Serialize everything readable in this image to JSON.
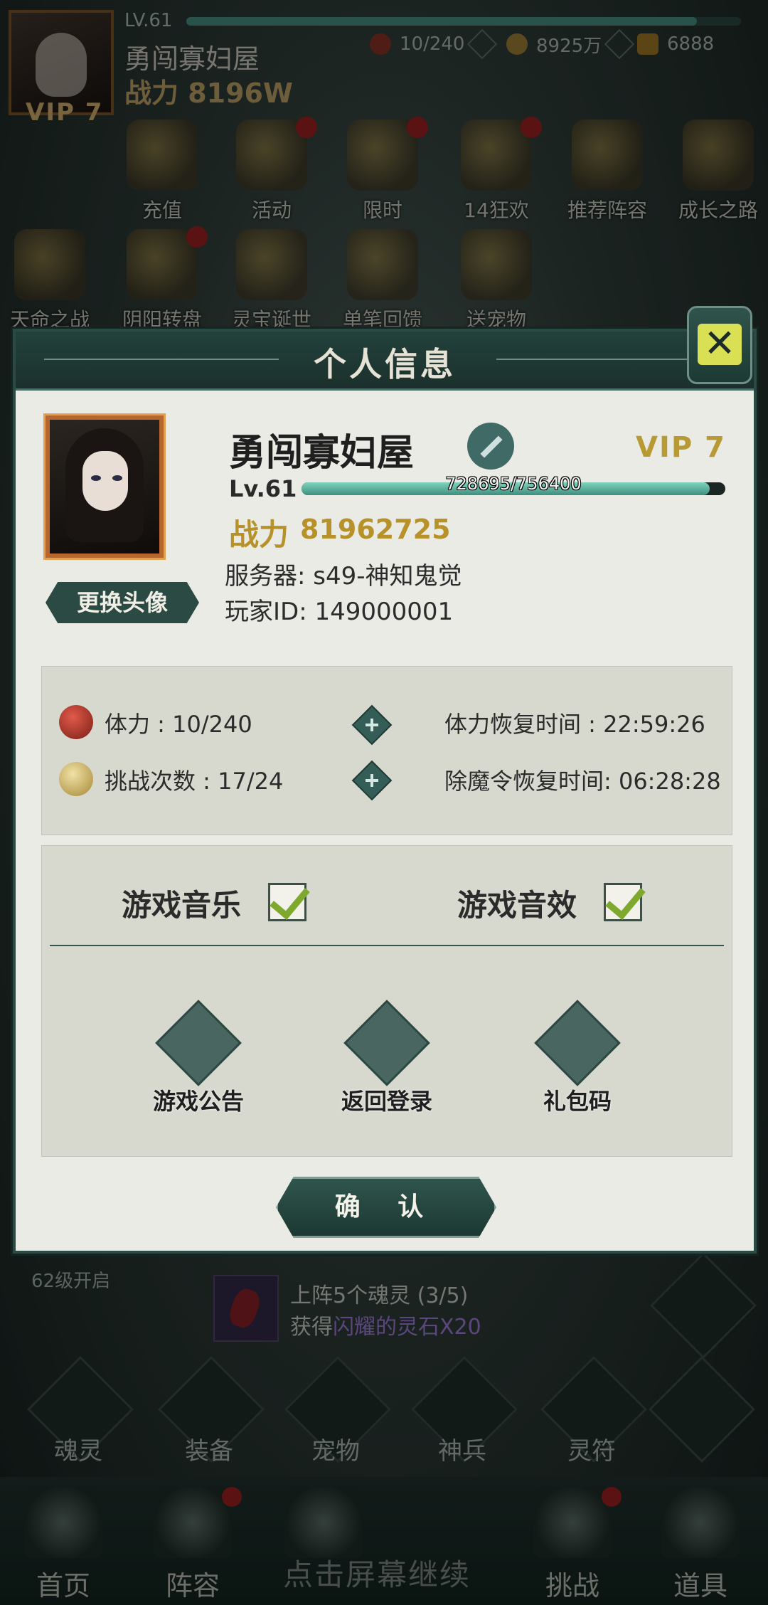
{
  "hud": {
    "level": "LV.61",
    "name": "勇闯寡妇屋",
    "power": "战力 8196W",
    "vip": "VIP 7",
    "stamina": "10/240",
    "gold": "8925万",
    "ingots": "6888"
  },
  "events_row1": [
    {
      "label": "充值",
      "icon": "recharge-icon",
      "dot": false
    },
    {
      "label": "活动",
      "icon": "activity-icon",
      "dot": true
    },
    {
      "label": "限时",
      "icon": "limited-icon",
      "dot": true
    },
    {
      "label": "14狂欢",
      "icon": "carnival-icon",
      "dot": true
    },
    {
      "label": "推荐阵容",
      "icon": "lineup-icon",
      "dot": false
    },
    {
      "label": "成长之路",
      "icon": "growth-icon",
      "dot": false
    }
  ],
  "events_row2": [
    {
      "label": "天命之战",
      "icon": "destiny-icon",
      "dot": false
    },
    {
      "label": "阴阳转盘",
      "icon": "wheel-icon",
      "dot": true
    },
    {
      "label": "灵宝诞世",
      "icon": "treasure-icon",
      "dot": false
    },
    {
      "label": "单笔回馈",
      "icon": "coins-icon",
      "dot": false
    },
    {
      "label": "送宠物",
      "icon": "rabbit-icon",
      "dot": false
    }
  ],
  "lower_hud": {
    "unlock_text": "62级开启",
    "quest_line1": "上阵5个魂灵 (3/5)",
    "quest_line2_prefix": "获得",
    "quest_line2_item": "闪耀的灵石X20",
    "side_buttons": [
      "魂灵",
      "装备",
      "宠物",
      "神兵",
      "灵符"
    ]
  },
  "bottom_tabs": [
    {
      "label": "首页",
      "dot": false
    },
    {
      "label": "阵容",
      "dot": true
    },
    {
      "label": "挑战",
      "dot": true
    },
    {
      "label": "道具",
      "dot": false
    }
  ],
  "screen_recording_caption": "点击屏幕继续",
  "panel": {
    "title": "个人信息",
    "name": "勇闯寡妇屋",
    "vip": "VIP 7",
    "level": "Lv.61",
    "exp_text": "728695/756400",
    "exp_fraction": 0.9634,
    "power_label": "战力",
    "power_value": "81962725",
    "server": "服务器: s49-神知鬼觉",
    "player_id": "玩家ID:  149000001",
    "change_avatar": "更换头像",
    "stamina_label": "体力 : 10/240",
    "stamina_recover": "体力恢复时间 : 22:59:26",
    "challenge_label": "挑战次数 : 17/24",
    "challenge_recover": "除魔令恢复时间: 06:28:28",
    "music_label": "游戏音乐",
    "sfx_label": "游戏音效",
    "music_on": true,
    "sfx_on": true,
    "actions": [
      {
        "label": "游戏公告",
        "icon": "announcement-icon"
      },
      {
        "label": "返回登录",
        "icon": "return-login-icon"
      },
      {
        "label": "礼包码",
        "icon": "gift-code-icon"
      }
    ],
    "confirm": "确 认"
  },
  "colors": {
    "panel_bg": "#e9ebe4",
    "header": "#23413b",
    "accent_gold": "#b7922a",
    "exp_fill": "#3d8f7e"
  }
}
